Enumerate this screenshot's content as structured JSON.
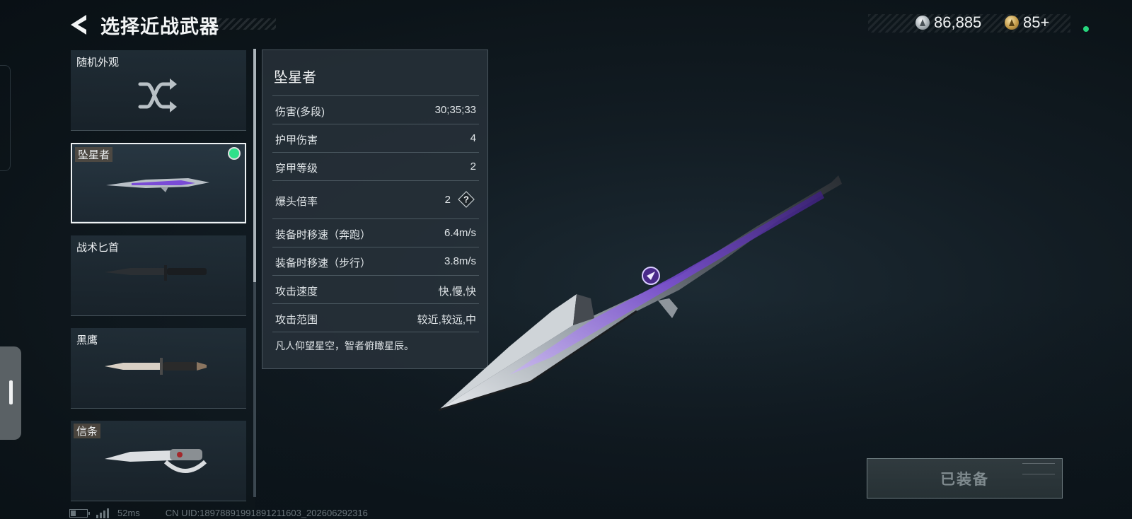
{
  "header": {
    "title": "选择近战武器",
    "currency": [
      {
        "icon": "silver-coin-icon",
        "value": "86,885"
      },
      {
        "icon": "gold-token-icon",
        "value": "85+"
      }
    ]
  },
  "weapon_list": [
    {
      "label": "随机外观",
      "icon": "shuffle-icon",
      "selected": false,
      "equipped": false
    },
    {
      "label": "坠星者",
      "icon": "starfall-knife-icon",
      "selected": true,
      "equipped": true
    },
    {
      "label": "战术匕首",
      "icon": "tactical-dagger-icon",
      "selected": false,
      "equipped": false
    },
    {
      "label": "黑鹰",
      "icon": "black-hawk-knife-icon",
      "selected": false,
      "equipped": false
    },
    {
      "label": "信条",
      "icon": "creed-knife-icon",
      "selected": false,
      "equipped": false
    }
  ],
  "stats": {
    "weapon_name": "坠星者",
    "rows": [
      {
        "label": "伤害(多段)",
        "value": "30;35;33"
      },
      {
        "label": "护甲伤害",
        "value": "4"
      },
      {
        "label": "穿甲等级",
        "value": "2"
      },
      {
        "label": "爆头倍率",
        "value": "2"
      },
      {
        "label": "装备时移速（奔跑）",
        "value": "6.4m/s"
      },
      {
        "label": "装备时移速（步行）",
        "value": "3.8m/s"
      },
      {
        "label": "攻击速度",
        "value": "快,慢,快"
      },
      {
        "label": "攻击范围",
        "value": "较近,较远,中"
      }
    ],
    "help_symbol": "?",
    "description": "凡人仰望星空，智者俯瞰星辰。"
  },
  "equip_button": {
    "label": "已装备"
  },
  "status_bar": {
    "ping": "52ms",
    "uid": "CN UID:18978891991891211603_202606292316"
  },
  "colors": {
    "equipped": "#2fe08a",
    "accent_purple": "#7a4bd6",
    "panel": "#28323a"
  }
}
